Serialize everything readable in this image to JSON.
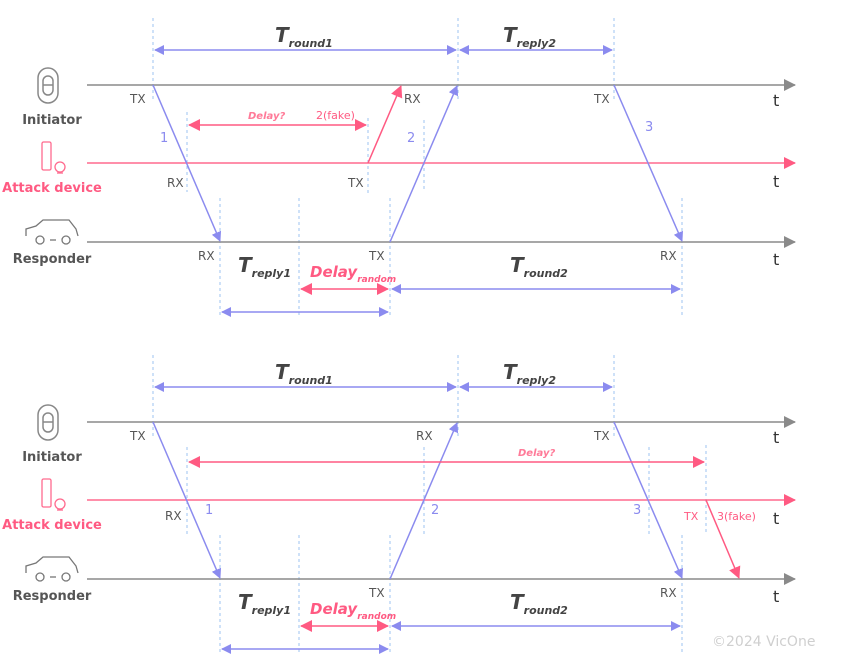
{
  "roles": {
    "initiator": "Initiator",
    "attack": "Attack device",
    "responder": "Responder"
  },
  "axis_label": "t",
  "T": "T",
  "delay_main": "Delay",
  "sub": {
    "round1": "round1",
    "reply2": "reply2",
    "reply1": "reply1",
    "random": "random",
    "round2": "round2"
  },
  "markers": {
    "tx": "TX",
    "rx": "RX"
  },
  "panel1": {
    "delay_q": "Delay?",
    "fake": "2(fake)",
    "m1": "1",
    "m2": "2",
    "m3": "3"
  },
  "panel2": {
    "delay_q": "Delay?",
    "fake": "3(fake)",
    "m1": "1",
    "m2": "2",
    "m3": "3"
  },
  "copyright": "©2024 VicOne",
  "colors": {
    "legit": "#8b8bef",
    "attack": "#ff5a82",
    "timeline": "#8a8a8a",
    "guide": "#9ec3f0"
  }
}
